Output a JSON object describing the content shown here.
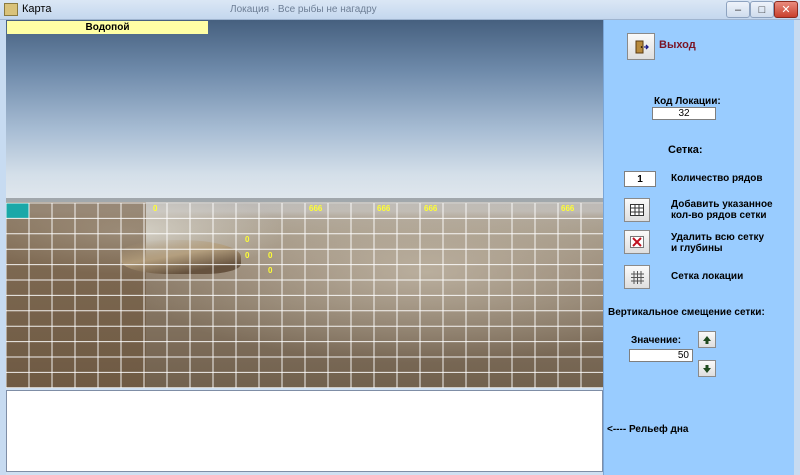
{
  "window": {
    "title": "Карта",
    "ghost_title": "Локация · Все рыбы не нагадру"
  },
  "map": {
    "caption": "Водопой",
    "depth_labels": [
      "0",
      "666",
      "666",
      "666",
      "666",
      "0",
      "0",
      "0",
      "0"
    ]
  },
  "panel": {
    "exit_label": "Выход",
    "location_code_label": "Код Локации:",
    "location_code_value": "32",
    "grid_heading": "Сетка:",
    "rows_count_value": "1",
    "rows_count_label": "Количество рядов",
    "add_rows_label_1": "Добавить указанное",
    "add_rows_label_2": "кол-во рядов сетки",
    "delete_grid_label_1": "Удалить всю сетку",
    "delete_grid_label_2": "и глубины",
    "location_grid_label": "Сетка локации",
    "vertical_offset_label": "Вертикальное смещение сетки:",
    "value_label": "Значение:",
    "offset_value": "50",
    "relief_label": "<---- Рельеф дна"
  },
  "colors": {
    "panel": "#99ccff",
    "caption": "#ffffa5",
    "depth_text": "#ffff33",
    "selected_cell": "#1aa8a8"
  },
  "icons": {
    "exit": "door-exit-icon",
    "add": "table-grid-icon",
    "delete": "delete-x-icon",
    "location_grid": "grid-icon",
    "up": "arrow-up-icon",
    "down": "arrow-down-icon"
  }
}
